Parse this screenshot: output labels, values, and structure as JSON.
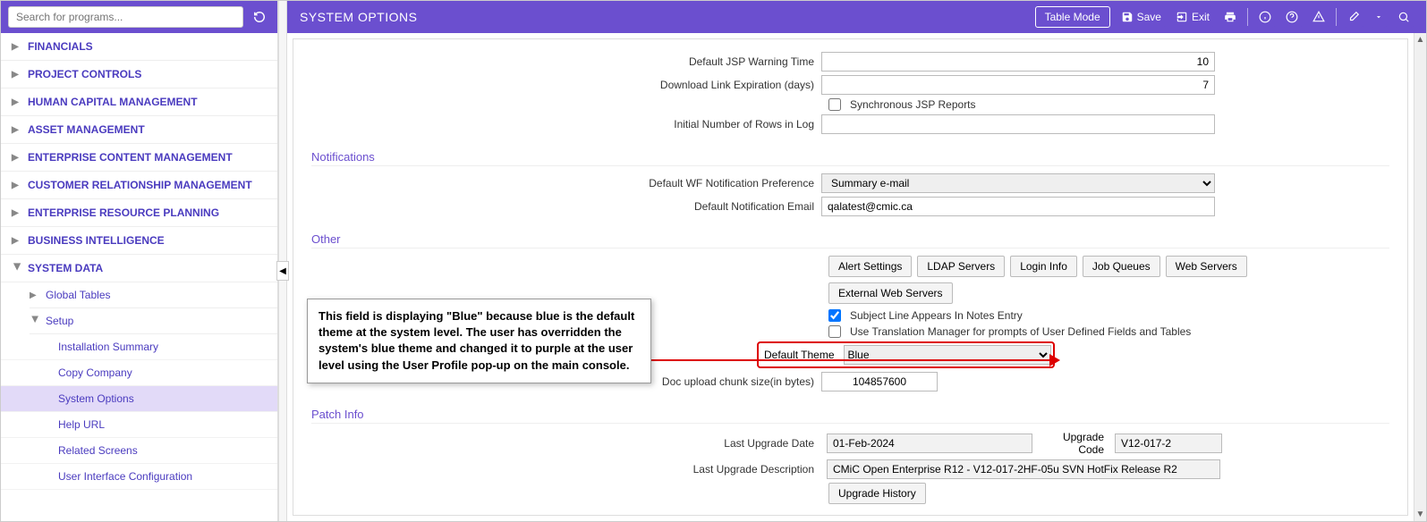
{
  "search": {
    "placeholder": "Search for programs..."
  },
  "nav": {
    "items": [
      "FINANCIALS",
      "PROJECT CONTROLS",
      "HUMAN CAPITAL MANAGEMENT",
      "ASSET MANAGEMENT",
      "ENTERPRISE CONTENT MANAGEMENT",
      "CUSTOMER RELATIONSHIP MANAGEMENT",
      "ENTERPRISE RESOURCE PLANNING",
      "BUSINESS INTELLIGENCE",
      "SYSTEM DATA"
    ],
    "system_data": {
      "global_tables": "Global Tables",
      "setup": "Setup",
      "leaves": [
        "Installation Summary",
        "Copy Company",
        "System Options",
        "Help URL",
        "Related Screens",
        "User Interface Configuration"
      ]
    }
  },
  "header": {
    "title": "SYSTEM OPTIONS",
    "table_mode": "Table Mode",
    "save": "Save",
    "exit": "Exit"
  },
  "form": {
    "jsp_warning_label": "Default JSP Warning Time",
    "jsp_warning_value": "10",
    "download_exp_label": "Download Link Expiration (days)",
    "download_exp_value": "7",
    "sync_jsp_label": "Synchronous JSP Reports",
    "initial_rows_label": "Initial Number of Rows in Log",
    "initial_rows_value": ""
  },
  "notifications": {
    "title": "Notifications",
    "wf_pref_label": "Default WF Notification Preference",
    "wf_pref_value": "Summary e-mail",
    "email_label": "Default Notification Email",
    "email_value": "qalatest@cmic.ca"
  },
  "other": {
    "title": "Other",
    "buttons": [
      "Alert Settings",
      "LDAP Servers",
      "Login Info",
      "Job Queues",
      "Web Servers",
      "External Web Servers"
    ],
    "subject_line_label": "Subject Line Appears In Notes Entry",
    "translation_label": "Use Translation Manager for prompts of User Defined Fields and Tables",
    "default_theme_label": "Default Theme",
    "default_theme_value": "Blue",
    "chunk_label": "Doc upload chunk size(in bytes)",
    "chunk_value": "104857600"
  },
  "patch": {
    "title": "Patch Info",
    "upgrade_date_label": "Last Upgrade Date",
    "upgrade_date_value": "01-Feb-2024",
    "upgrade_code_label": "Upgrade Code",
    "upgrade_code_value": "V12-017-2",
    "upgrade_desc_label": "Last Upgrade Description",
    "upgrade_desc_value": "CMiC Open Enterprise R12 - V12-017-2HF-05u SVN HotFix Release R2",
    "history_btn": "Upgrade History"
  },
  "callout": {
    "text": "This field is displaying \"Blue\" because blue is the default theme at the system level. The user has overridden the system's blue theme and changed it to purple at the user level using the User Profile pop-up on the main console."
  }
}
